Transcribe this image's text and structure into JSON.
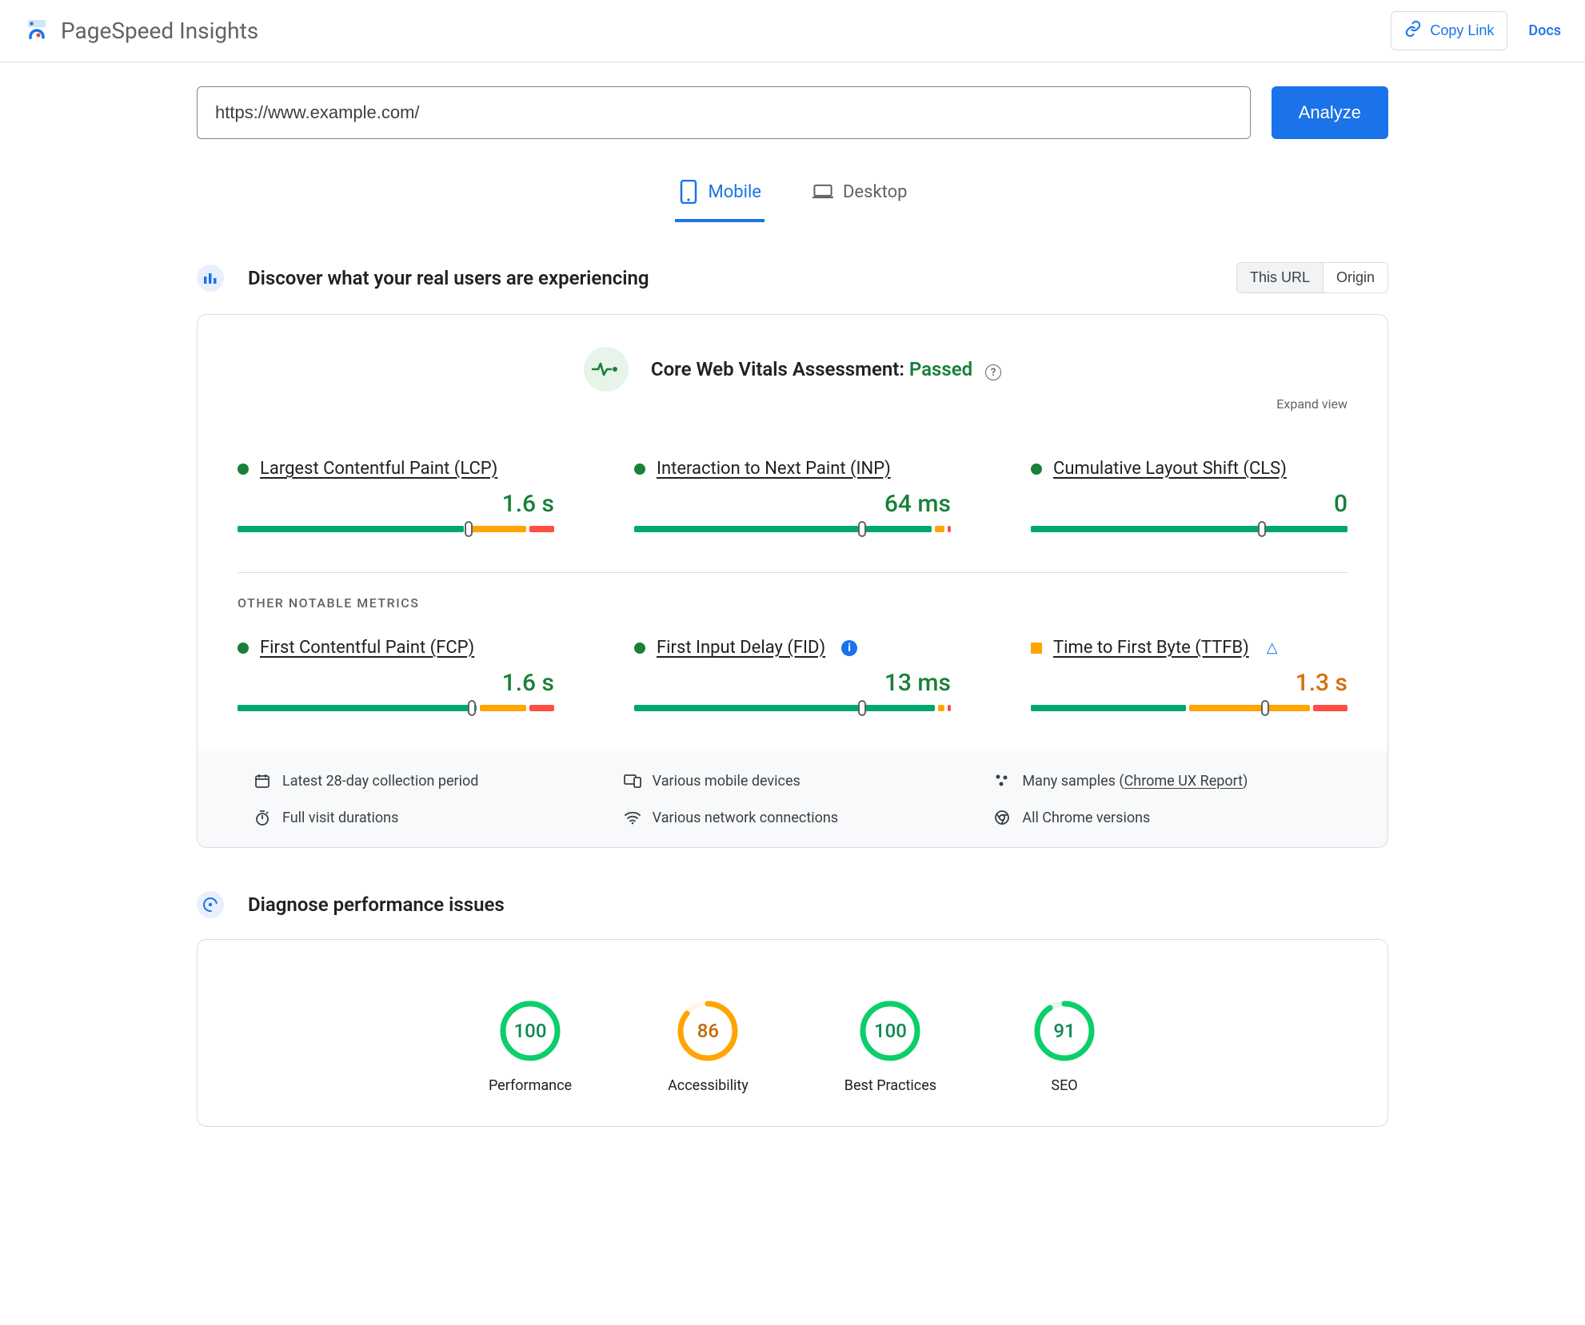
{
  "header": {
    "title": "PageSpeed Insights",
    "copy_link": "Copy Link",
    "docs": "Docs"
  },
  "search": {
    "url": "https://www.example.com/",
    "analyze": "Analyze"
  },
  "tabs": {
    "mobile": "Mobile",
    "desktop": "Desktop"
  },
  "discover": {
    "title": "Discover what your real users are experiencing",
    "scope": {
      "this_url": "This URL",
      "origin": "Origin"
    }
  },
  "assessment": {
    "label": "Core Web Vitals Assessment: ",
    "status": "Passed",
    "expand": "Expand view"
  },
  "metrics": {
    "lcp": {
      "name": "Largest Contentful Paint (LCP)",
      "value": "1.6 s",
      "green_pct": 73,
      "orange_pct": 19,
      "red_pct": 8,
      "marker_pct": 73
    },
    "inp": {
      "name": "Interaction to Next Paint (INP)",
      "value": "64 ms",
      "green_pct": 96,
      "orange_pct": 3,
      "red_pct": 1,
      "marker_pct": 72
    },
    "cls": {
      "name": "Cumulative Layout Shift (CLS)",
      "value": "0",
      "green_pct": 100,
      "orange_pct": 0,
      "red_pct": 0,
      "marker_pct": 73
    },
    "fcp": {
      "name": "First Contentful Paint (FCP)",
      "value": "1.6 s",
      "green_pct": 77,
      "orange_pct": 15,
      "red_pct": 8,
      "marker_pct": 74
    },
    "fid": {
      "name": "First Input Delay (FID)",
      "value": "13 ms",
      "green_pct": 97,
      "orange_pct": 2,
      "red_pct": 1,
      "marker_pct": 72
    },
    "ttfb": {
      "name": "Time to First Byte (TTFB)",
      "value": "1.3 s",
      "green_pct": 50,
      "orange_pct": 39,
      "red_pct": 11,
      "marker_pct": 74
    }
  },
  "subheading": "OTHER NOTABLE METRICS",
  "footer": {
    "period": "Latest 28-day collection period",
    "devices": "Various mobile devices",
    "samples_prefix": "Many samples (",
    "samples_link": "Chrome UX Report",
    "samples_suffix": ")",
    "durations": "Full visit durations",
    "networks": "Various network connections",
    "versions": "All Chrome versions"
  },
  "diagnose": {
    "title": "Diagnose performance issues",
    "scores": [
      {
        "label": "Performance",
        "value": "100",
        "pct": 100,
        "color": "#0cce6b",
        "bg": "#e6f7ee",
        "text": "#0a8a4f"
      },
      {
        "label": "Accessibility",
        "value": "86",
        "pct": 86,
        "color": "#ffa400",
        "bg": "#fff7e6",
        "text": "#c26a00"
      },
      {
        "label": "Best Practices",
        "value": "100",
        "pct": 100,
        "color": "#0cce6b",
        "bg": "#e6f7ee",
        "text": "#0a8a4f"
      },
      {
        "label": "SEO",
        "value": "91",
        "pct": 91,
        "color": "#0cce6b",
        "bg": "#e6f7ee",
        "text": "#0a8a4f"
      }
    ]
  }
}
